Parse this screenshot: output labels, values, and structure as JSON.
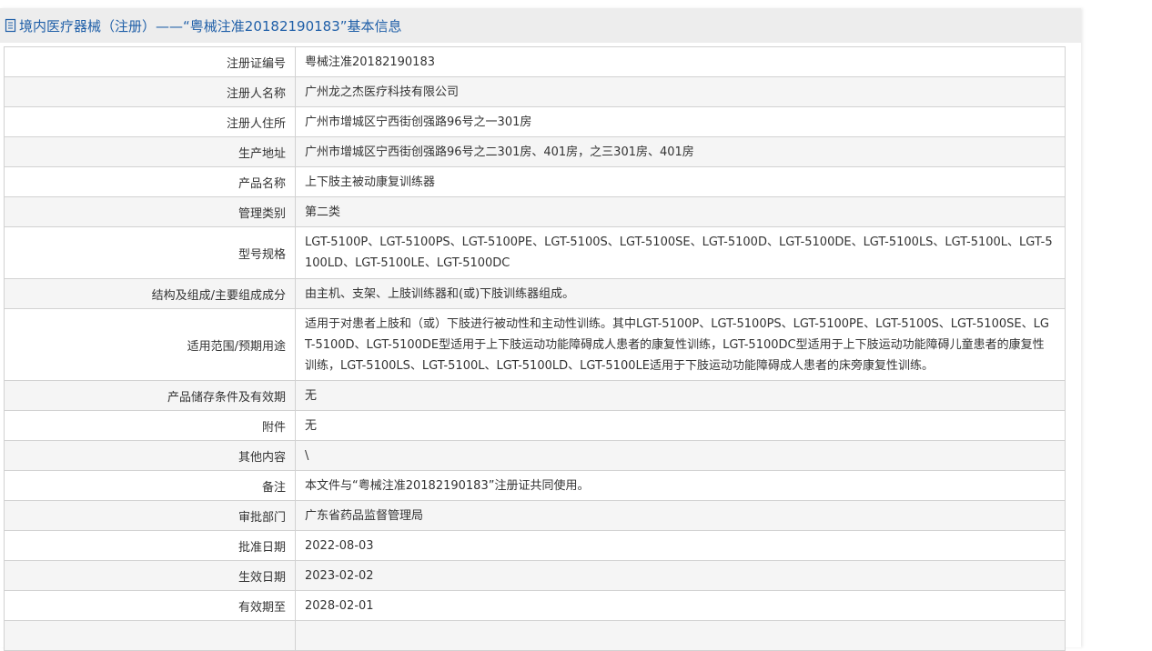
{
  "header": {
    "title": "境内医疗器械（注册）——“粤械注准20182190183”基本信息",
    "icon": "document-icon"
  },
  "rows": [
    {
      "label": "注册证编号",
      "value": "粤械注准20182190183"
    },
    {
      "label": "注册人名称",
      "value": "广州龙之杰医疗科技有限公司"
    },
    {
      "label": "注册人住所",
      "value": "广州市增城区宁西街创强路96号之一301房"
    },
    {
      "label": "生产地址",
      "value": "广州市增城区宁西街创强路96号之二301房、401房，之三301房、401房"
    },
    {
      "label": "产品名称",
      "value": "上下肢主被动康复训练器"
    },
    {
      "label": "管理类别",
      "value": "第二类"
    },
    {
      "label": "型号规格",
      "value": "LGT-5100P、LGT-5100PS、LGT-5100PE、LGT-5100S、LGT-5100SE、LGT-5100D、LGT-5100DE、LGT-5100LS、LGT-5100L、LGT-5100LD、LGT-5100LE、LGT-5100DC"
    },
    {
      "label": "结构及组成/主要组成成分",
      "value": "由主机、支架、上肢训练器和(或)下肢训练器组成。"
    },
    {
      "label": "适用范围/预期用途",
      "value": "适用于对患者上肢和（或）下肢进行被动性和主动性训练。其中LGT-5100P、LGT-5100PS、LGT-5100PE、LGT-5100S、LGT-5100SE、LGT-5100D、LGT-5100DE型适用于上下肢运动功能障碍成人患者的康复性训练，LGT-5100DC型适用于上下肢运动功能障碍儿童患者的康复性训练，LGT-5100LS、LGT-5100L、LGT-5100LD、LGT-5100LE适用于下肢运动功能障碍成人患者的床旁康复性训练。"
    },
    {
      "label": "产品储存条件及有效期",
      "value": "无"
    },
    {
      "label": "附件",
      "value": "无"
    },
    {
      "label": "其他内容",
      "value": "\\"
    },
    {
      "label": "备注",
      "value": "本文件与“粤械注准20182190183”注册证共同使用。"
    },
    {
      "label": "审批部门",
      "value": "广东省药品监督管理局"
    },
    {
      "label": "批准日期",
      "value": "2022-08-03"
    },
    {
      "label": "生效日期",
      "value": "2023-02-02"
    },
    {
      "label": "有效期至",
      "value": "2028-02-01"
    },
    {
      "label": "",
      "value": ""
    }
  ]
}
